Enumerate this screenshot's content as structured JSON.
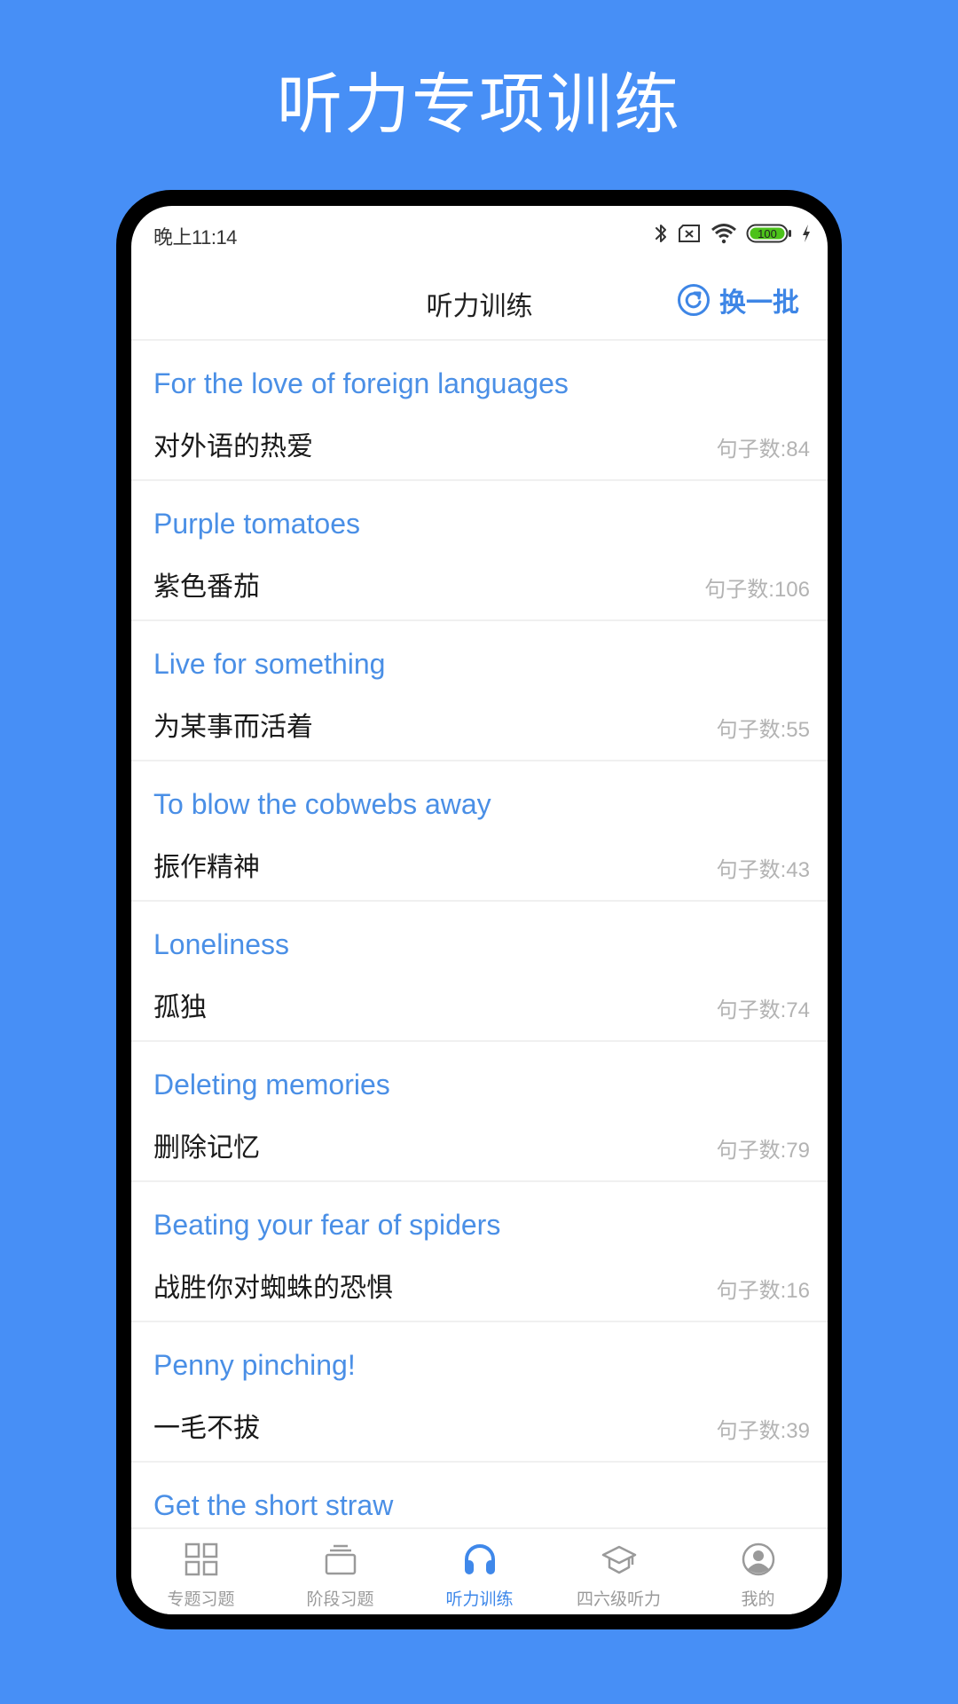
{
  "promo": {
    "title": "听力专项训练",
    "background_color": "#478ff6"
  },
  "status_bar": {
    "time": "晚上11:14",
    "icons": [
      "bluetooth-icon",
      "no-sim-icon",
      "wifi-icon",
      "battery-icon",
      "charging-icon"
    ],
    "battery_level": "100",
    "battery_color": "#4cc21a"
  },
  "header": {
    "title": "听力训练",
    "refresh_label": "换一批",
    "refresh_icon": "refresh-icon",
    "accent_color": "#3e86e6"
  },
  "list": {
    "count_prefix": "句子数:",
    "items": [
      {
        "title": "For the love of foreign languages",
        "subtitle": "对外语的热爱",
        "count": "句子数:84"
      },
      {
        "title": "Purple tomatoes",
        "subtitle": "紫色番茄",
        "count": "句子数:106"
      },
      {
        "title": "Live for something",
        "subtitle": "为某事而活着",
        "count": "句子数:55"
      },
      {
        "title": "To blow the cobwebs away",
        "subtitle": "振作精神",
        "count": "句子数:43"
      },
      {
        "title": "Loneliness",
        "subtitle": "孤独",
        "count": "句子数:74"
      },
      {
        "title": "Deleting memories",
        "subtitle": "删除记忆",
        "count": "句子数:79"
      },
      {
        "title": "Beating your fear of spiders",
        "subtitle": "战胜你对蜘蛛的恐惧",
        "count": "句子数:16"
      },
      {
        "title": "Penny pinching!",
        "subtitle": "一毛不拔",
        "count": "句子数:39"
      },
      {
        "title": "Get the short straw",
        "subtitle": "",
        "count": ""
      }
    ]
  },
  "bottom_nav": {
    "active_index": 2,
    "active_color": "#3f88ea",
    "items": [
      {
        "label": "专题习题",
        "icon": "grid-icon"
      },
      {
        "label": "阶段习题",
        "icon": "stack-icon"
      },
      {
        "label": "听力训练",
        "icon": "headphones-icon"
      },
      {
        "label": "四六级听力",
        "icon": "graduation-cap-icon"
      },
      {
        "label": "我的",
        "icon": "user-circle-icon"
      }
    ]
  }
}
